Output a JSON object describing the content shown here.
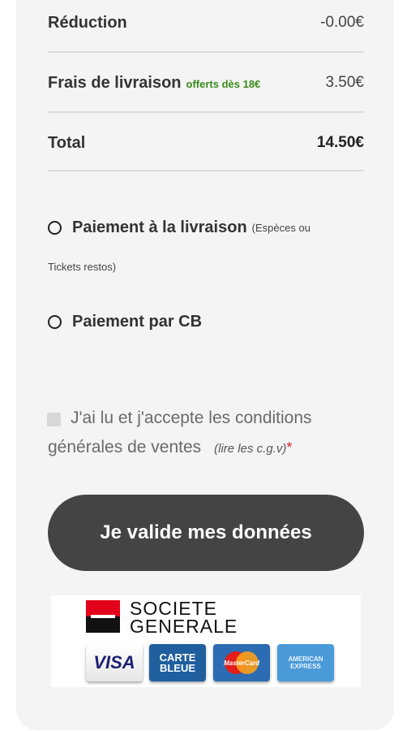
{
  "summary": {
    "reduction_label": "Réduction",
    "reduction_value": "-0.00€",
    "delivery_label": "Frais de livraison",
    "delivery_note": "offerts dès 18€",
    "delivery_value": "3.50€",
    "total_label": "Total",
    "total_value": "14.50€"
  },
  "payment": {
    "cash_label": "Paiement à la livraison",
    "cash_note": "(Espèces ou",
    "cash_note_cont": "Tickets restos)",
    "card_label": "Paiement par CB"
  },
  "terms": {
    "line1": "J'ai lu et j'accepte les conditions",
    "line2": "générales de ventes",
    "link": "(lire les c.g.v)",
    "required": "*"
  },
  "submit_label": "Je valide mes données",
  "logos": {
    "bank_line1": "SOCIETE",
    "bank_line2": "GENERALE",
    "visa": "VISA",
    "cb_line1": "CARTE",
    "cb_line2": "BLEUE",
    "mastercard": "MasterCard",
    "amex_line1": "AMERICAN",
    "amex_line2": "EXPRESS"
  },
  "colors": {
    "accent_green": "#3a8a1a",
    "button_bg": "#444444",
    "required_red": "#d0202a",
    "bank_red": "#e2001a"
  }
}
